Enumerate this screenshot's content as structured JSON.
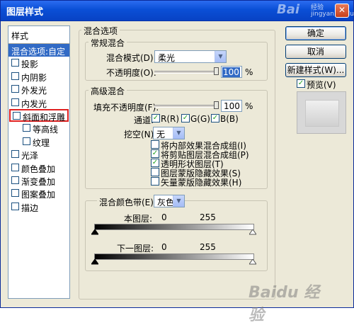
{
  "window": {
    "title": "图层样式",
    "close_glyph": "✕"
  },
  "watermark": {
    "logo": "Bai",
    "site_cn": "经验",
    "site_url": "jingyan.baidu.com",
    "bottom": "Baidu 经验"
  },
  "style_list": {
    "header": "样式",
    "items": [
      {
        "label": "混合选项:自定",
        "checkbox": false,
        "selected": true
      },
      {
        "label": "投影",
        "checkbox": true,
        "checked": false
      },
      {
        "label": "内阴影",
        "checkbox": true,
        "checked": false
      },
      {
        "label": "外发光",
        "checkbox": true,
        "checked": false
      },
      {
        "label": "内发光",
        "checkbox": true,
        "checked": false
      },
      {
        "label": "斜面和浮雕",
        "checkbox": true,
        "checked": false,
        "highlighted": true
      },
      {
        "label": "等高线",
        "checkbox": true,
        "checked": false,
        "indent": true
      },
      {
        "label": "纹理",
        "checkbox": true,
        "checked": false,
        "indent": true
      },
      {
        "label": "光泽",
        "checkbox": true,
        "checked": false
      },
      {
        "label": "颜色叠加",
        "checkbox": true,
        "checked": false
      },
      {
        "label": "渐变叠加",
        "checkbox": true,
        "checked": false
      },
      {
        "label": "图案叠加",
        "checkbox": true,
        "checked": false
      },
      {
        "label": "描边",
        "checkbox": true,
        "checked": false
      }
    ]
  },
  "blend": {
    "section_title": "混合选项",
    "general": {
      "title": "常规混合",
      "mode_label": "混合模式(D):",
      "mode_value": "柔光",
      "opacity_label": "不透明度(O):",
      "opacity_value": "100",
      "opacity_unit": "%",
      "opacity_fraction": 1.0
    },
    "advanced": {
      "title": "高级混合",
      "fill_label": "填充不透明度(F):",
      "fill_value": "100",
      "fill_unit": "%",
      "fill_fraction": 1.0,
      "channels_label": "通道:",
      "channels": [
        {
          "label": "R(R)",
          "checked": true
        },
        {
          "label": "G(G)",
          "checked": true
        },
        {
          "label": "B(B)",
          "checked": true
        }
      ],
      "knockout_label": "挖空(N):",
      "knockout_value": "无",
      "options": [
        {
          "label": "将内部效果混合成组(I)",
          "checked": false
        },
        {
          "label": "将剪贴图层混合成组(P)",
          "checked": true
        },
        {
          "label": "透明形状图层(T)",
          "checked": true
        },
        {
          "label": "图层蒙版隐藏效果(S)",
          "checked": false
        },
        {
          "label": "矢量蒙版隐藏效果(H)",
          "checked": false
        }
      ]
    },
    "blend_if": {
      "label": "混合颜色带(E):",
      "value": "灰色",
      "this_layer_label": "本图层:",
      "this_layer_min": "0",
      "this_layer_max": "255",
      "underlying_label": "下一图层:",
      "underlying_min": "0",
      "underlying_max": "255"
    }
  },
  "buttons": {
    "ok": "确定",
    "cancel": "取消",
    "new_style": "新建样式(W)..."
  },
  "preview": {
    "label": "预览(V)",
    "checked": true
  },
  "colors": {
    "title_bar": "#0a4fd6",
    "selection": "#316ac5",
    "highlight_box": "#e02020",
    "dialog_bg": "#ece9d8"
  }
}
